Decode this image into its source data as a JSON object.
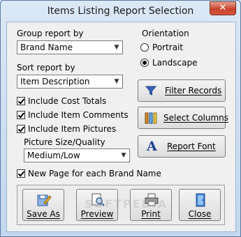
{
  "window": {
    "title": "Items Listing Report Selection",
    "close_glyph": "✕"
  },
  "group_report": {
    "label": "Group report by",
    "value": "Brand Name"
  },
  "sort_report": {
    "label": "Sort report by",
    "value": "Item Description"
  },
  "checkboxes": {
    "cost_totals": {
      "label": "Include Cost Totals",
      "checked": true
    },
    "item_comments": {
      "label": "Include Item Comments",
      "checked": true
    },
    "item_pictures": {
      "label": "Include Item Pictures",
      "checked": true
    },
    "new_page": {
      "label": "New Page for each Brand Name",
      "checked": true
    }
  },
  "picture_quality": {
    "label": "Picture Size/Quality",
    "value": "Medium/Low"
  },
  "orientation": {
    "label": "Orientation",
    "portrait": "Portrait",
    "landscape": "Landscape",
    "selected": "Landscape"
  },
  "side_buttons": {
    "filter": "Filter Records",
    "columns": "Select Columns",
    "font": "Report Font"
  },
  "bottom_buttons": {
    "save_as": "Save As",
    "preview": "Preview",
    "print": "Print",
    "close": "Close"
  },
  "watermark": "SOFTPEDIA"
}
